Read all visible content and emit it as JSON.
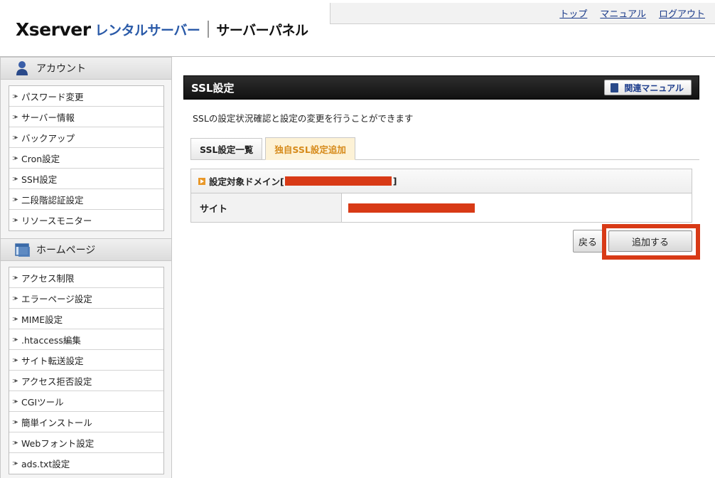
{
  "header": {
    "logo_brand": "Xserver",
    "logo_product": "レンタルサーバー",
    "logo_panel": "サーバーパネル",
    "nav": [
      {
        "label": "トップ"
      },
      {
        "label": "マニュアル"
      },
      {
        "label": "ログアウト"
      }
    ]
  },
  "sidebar": {
    "sections": [
      {
        "title": "アカウント",
        "icon": "user-icon",
        "items": [
          {
            "label": "パスワード変更"
          },
          {
            "label": "サーバー情報"
          },
          {
            "label": "バックアップ"
          },
          {
            "label": "Cron設定"
          },
          {
            "label": "SSH設定"
          },
          {
            "label": "二段階認証設定"
          },
          {
            "label": "リソースモニター"
          }
        ]
      },
      {
        "title": "ホームページ",
        "icon": "window-icon",
        "items": [
          {
            "label": "アクセス制限"
          },
          {
            "label": "エラーページ設定"
          },
          {
            "label": "MIME設定"
          },
          {
            "label": ".htaccess編集"
          },
          {
            "label": "サイト転送設定"
          },
          {
            "label": "アクセス拒否設定"
          },
          {
            "label": "CGIツール"
          },
          {
            "label": "簡単インストール"
          },
          {
            "label": "Webフォント設定"
          },
          {
            "label": "ads.txt設定"
          }
        ]
      }
    ]
  },
  "main": {
    "title": "SSL設定",
    "manual_button": "関連マニュアル",
    "description": "SSLの設定状況確認と設定の変更を行うことができます",
    "tabs": [
      {
        "label": "SSL設定一覧",
        "active": false
      },
      {
        "label": "独自SSL設定追加",
        "active": true
      }
    ],
    "domain_label_prefix": "設定対象ドメイン[",
    "domain_label_suffix": "]",
    "site_label": "サイト",
    "back_button": "戻る",
    "add_button": "追加する"
  },
  "colors": {
    "accent_orange": "#e8982a",
    "redaction": "#d83a16",
    "link_blue": "#1a3a8a"
  }
}
